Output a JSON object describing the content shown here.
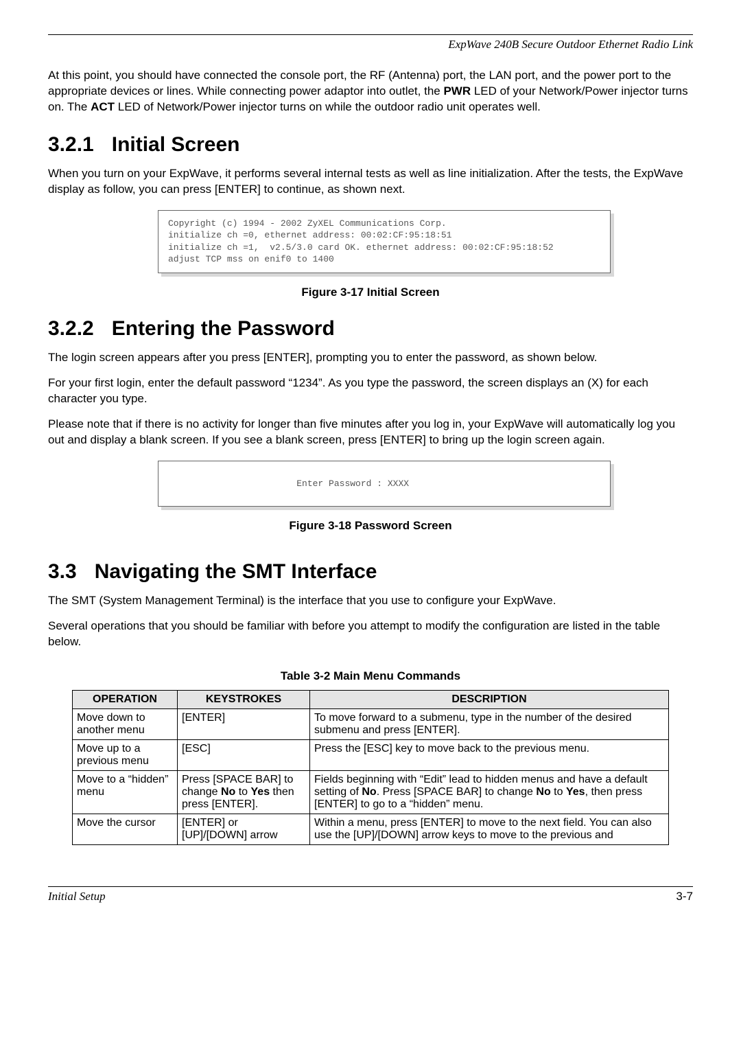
{
  "header": {
    "doc_title": "ExpWave 240B Secure Outdoor Ethernet Radio Link"
  },
  "intro_para": "At this point, you should have connected the console port, the RF (Antenna) port, the LAN port, and the power port to the appropriate devices or lines. While connecting power adaptor into outlet, the ",
  "intro_bold1": "PWR",
  "intro_mid": " LED of your Network/Power injector turns on. The ",
  "intro_bold2": "ACT",
  "intro_end": " LED of Network/Power injector turns on while the outdoor radio unit operates well.",
  "sec321": {
    "num": "3.2.1",
    "title": "Initial Screen",
    "para": "When you turn on your ExpWave, it performs several internal tests as well as line initialization. After the tests, the ExpWave display as follow, you can press [ENTER] to continue, as shown next.",
    "console": "Copyright (c) 1994 - 2002 ZyXEL Communications Corp.\ninitialize ch =0, ethernet address: 00:02:CF:95:18:51\ninitialize ch =1,  v2.5/3.0 card OK. ethernet address: 00:02:CF:95:18:52\nadjust TCP mss on enif0 to 1400",
    "figcap": "Figure 3-17 Initial Screen"
  },
  "sec322": {
    "num": "3.2.2",
    "title": "Entering the Password",
    "p1": "The login screen appears after you press [ENTER], prompting you to enter the password, as shown below.",
    "p2": "For your first login, enter the default password “1234”. As you type the password, the screen displays an (X) for each character you type.",
    "p3": "Please note that if there is no activity for longer than five minutes after you log in, your ExpWave will automatically log you out and display a blank screen. If you see a blank screen, press [ENTER] to bring up the login screen again.",
    "console": "                        Enter Password : XXXX",
    "figcap": "Figure 3-18 Password Screen"
  },
  "sec33": {
    "num": "3.3",
    "title": "Navigating the SMT Interface",
    "p1": "The SMT (System Management Terminal) is the interface that you use to configure your ExpWave.",
    "p2": "Several operations that you should be familiar with before you attempt to modify the configuration are listed in the table below.",
    "tabcap": "Table 3-2 Main Menu Commands",
    "headers": {
      "c1": "OPERATION",
      "c2": "KEYSTROKES",
      "c3": "DESCRIPTION"
    },
    "rows": [
      {
        "op": "Move down to another menu",
        "keys": "[ENTER]",
        "desc": "To move forward to a submenu, type in the number of the desired submenu and press [ENTER]."
      },
      {
        "op": "Move up to a previous menu",
        "keys": "[ESC]",
        "desc": "Press the [ESC] key to move back to the previous menu."
      },
      {
        "op": "Move to a “hidden” menu",
        "keys_pre": "Press [SPACE BAR] to change ",
        "keys_b1": "No",
        "keys_mid1": " to ",
        "keys_b2": "Yes",
        "keys_mid2": " then press [ENTER].",
        "desc_pre": "Fields beginning with “Edit” lead to hidden menus and have a default setting of ",
        "desc_b1": "No",
        "desc_mid1": ". Press [SPACE BAR] to change ",
        "desc_b2": "No",
        "desc_mid2": " to ",
        "desc_b3": "Yes",
        "desc_end": ", then press [ENTER] to go to a “hidden” menu."
      },
      {
        "op": "Move the cursor",
        "keys": "[ENTER] or [UP]/[DOWN] arrow",
        "desc": "Within a menu, press [ENTER] to move to the next field. You can also use the [UP]/[DOWN] arrow keys to move to the previous and"
      }
    ]
  },
  "footer": {
    "section": "Initial Setup",
    "page": "3-7"
  }
}
